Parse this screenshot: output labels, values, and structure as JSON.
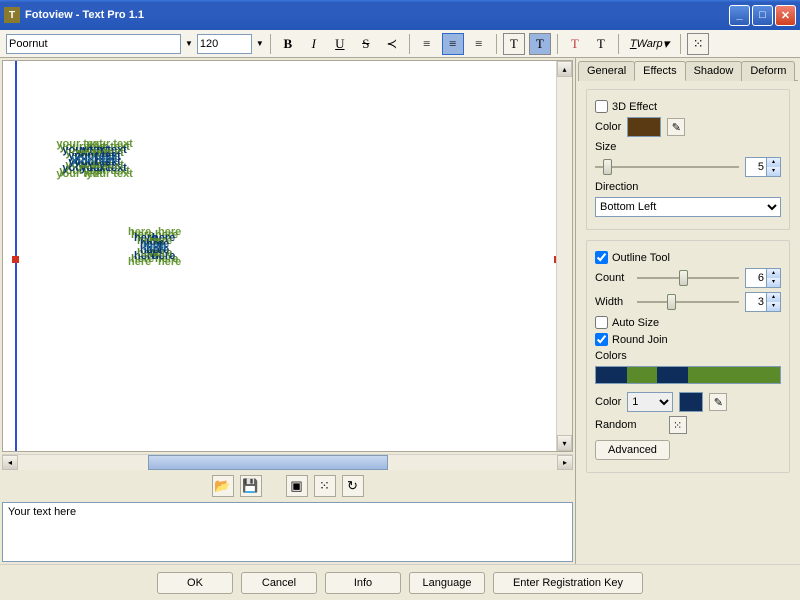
{
  "window": {
    "title": "Fotoview - Text Pro 1.1"
  },
  "toolbar": {
    "font": "Poornut",
    "size": "120",
    "bold": "B",
    "italic": "I",
    "underline": "U",
    "strike": "S",
    "warp_label": "Warp"
  },
  "canvas_text": {
    "line1": "your text",
    "line2": "here"
  },
  "text_input": "Your text here",
  "tabs": {
    "general": "General",
    "effects": "Effects",
    "shadow": "Shadow",
    "deform": "Deform"
  },
  "effects": {
    "threeD": {
      "label": "3D Effect",
      "checked": false,
      "color_label": "Color",
      "color_hex": "#5a3a12",
      "size_label": "Size",
      "size": "5",
      "direction_label": "Direction",
      "direction": "Bottom Left"
    },
    "outline": {
      "label": "Outline Tool",
      "checked": true,
      "count_label": "Count",
      "count": "6",
      "width_label": "Width",
      "width": "3",
      "autosize_label": "Auto Size",
      "autosize": false,
      "roundjoin_label": "Round Join",
      "roundjoin": true,
      "colors_label": "Colors",
      "strip": [
        "#0f2d5a",
        "#5a8a2a",
        "#0f2d5a",
        "#5a8a2a",
        "#5a8a2a",
        "#5a8a2a"
      ],
      "color_label": "Color",
      "color_index": "1",
      "color_hex": "#0f2d5a",
      "random_label": "Random",
      "advanced_label": "Advanced"
    }
  },
  "buttons": {
    "ok": "OK",
    "cancel": "Cancel",
    "info": "Info",
    "language": "Language",
    "register": "Enter Registration Key"
  }
}
